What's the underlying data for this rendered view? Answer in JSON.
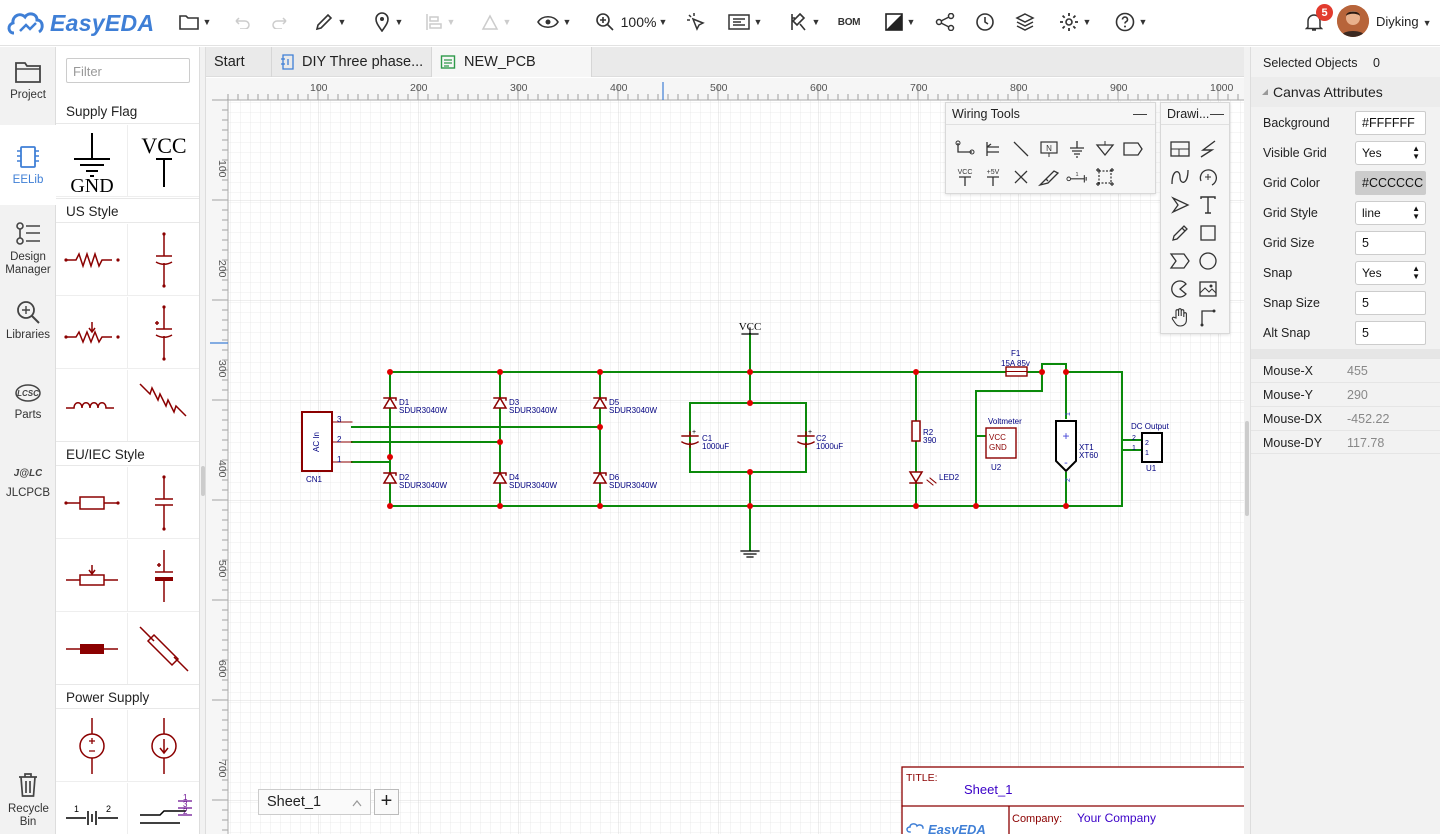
{
  "app": {
    "name": "EasyEDA"
  },
  "toolbar": {
    "zoom": "100%",
    "bom_label": "BOM",
    "notifications": "5",
    "user": "Diyking"
  },
  "leftnav": [
    {
      "label": "Project",
      "icon": "folder-icon"
    },
    {
      "label": "EELib",
      "icon": "chip-icon"
    },
    {
      "label": "Design Manager",
      "icon": "design-manager-icon"
    },
    {
      "label": "Libraries",
      "icon": "libraries-icon"
    },
    {
      "label": "Parts",
      "icon": "lcsc-icon"
    },
    {
      "label": "JLCPCB",
      "icon": "jlc-icon"
    },
    {
      "label": "Recycle Bin",
      "icon": "trash-icon"
    }
  ],
  "library": {
    "filter_placeholder": "Filter",
    "categories": [
      "Supply Flag",
      "US Style",
      "EU/IEC Style",
      "Power Supply"
    ],
    "gnd_label": "GND",
    "vcc_label": "VCC"
  },
  "tabs": [
    {
      "label": "Start"
    },
    {
      "label": "DIY Three phase..."
    },
    {
      "label": "NEW_PCB"
    }
  ],
  "ruler": {
    "x_ticks": [
      "100",
      "200",
      "300",
      "400",
      "500",
      "600",
      "700",
      "800",
      "900",
      "1000"
    ],
    "y_ticks": [
      "100",
      "200",
      "300",
      "400",
      "500",
      "600",
      "700"
    ]
  },
  "wiring_tools": {
    "title": "Wiring Tools",
    "vcc": "VCC",
    "plus5v": "+5V"
  },
  "drawing_tools": {
    "title": "Drawi..."
  },
  "schematic": {
    "vcc_label": "VCC",
    "cn1": {
      "ref": "CN1",
      "name": "AC In",
      "pins": [
        "3",
        "2",
        "1"
      ]
    },
    "diodes": [
      {
        "ref": "D1",
        "value": "SDUR3040W"
      },
      {
        "ref": "D3",
        "value": "SDUR3040W"
      },
      {
        "ref": "D5",
        "value": "SDUR3040W"
      },
      {
        "ref": "D2",
        "value": "SDUR3040W"
      },
      {
        "ref": "D4",
        "value": "SDUR3040W"
      },
      {
        "ref": "D6",
        "value": "SDUR3040W"
      }
    ],
    "caps": [
      {
        "ref": "C1",
        "value": "1000uF"
      },
      {
        "ref": "C2",
        "value": "1000uF"
      }
    ],
    "r2": {
      "ref": "R2",
      "value": "390"
    },
    "led2": {
      "ref": "LED2"
    },
    "f1": {
      "ref": "F1",
      "value": "15A 85v"
    },
    "voltmeter": {
      "title": "Voltmeter",
      "pin_vcc": "VCC",
      "pin_gnd": "GND",
      "ref": "U2"
    },
    "xt1": {
      "ref": "XT1",
      "value": "XT60",
      "plus": "+",
      "minus": "-",
      "p1": "1",
      "p2": "2"
    },
    "u1": {
      "title": "DC Output",
      "ref": "U1",
      "p1": "1",
      "p2": "2"
    },
    "title_block": {
      "title_label": "TITLE:",
      "title_value": "Sheet_1",
      "company_label": "Company:",
      "company_value": "Your Company",
      "logo": "EasyEDA"
    }
  },
  "sheet": {
    "name": "Sheet_1",
    "add": "+"
  },
  "properties": {
    "selected_label": "Selected Objects",
    "selected_count": "0",
    "section": "Canvas Attributes",
    "rows": [
      {
        "label": "Background",
        "value": "#FFFFFF",
        "kind": "input"
      },
      {
        "label": "Visible Grid",
        "value": "Yes",
        "kind": "select"
      },
      {
        "label": "Grid Color",
        "value": "#CCCCCC",
        "kind": "color"
      },
      {
        "label": "Grid Style",
        "value": "line",
        "kind": "select"
      },
      {
        "label": "Grid Size",
        "value": "5",
        "kind": "input"
      },
      {
        "label": "Snap",
        "value": "Yes",
        "kind": "select"
      },
      {
        "label": "Snap Size",
        "value": "5",
        "kind": "input"
      },
      {
        "label": "Alt Snap",
        "value": "5",
        "kind": "input"
      }
    ],
    "mouse": [
      {
        "label": "Mouse-X",
        "value": "455"
      },
      {
        "label": "Mouse-Y",
        "value": "290"
      },
      {
        "label": "Mouse-DX",
        "value": "-452.22"
      },
      {
        "label": "Mouse-DY",
        "value": "117.78"
      }
    ]
  },
  "colors": {
    "wire": "#0b8a0b",
    "part": "#8b0000",
    "label": "#000080",
    "junction": "#e00000",
    "accent": "#3f7fd6"
  }
}
